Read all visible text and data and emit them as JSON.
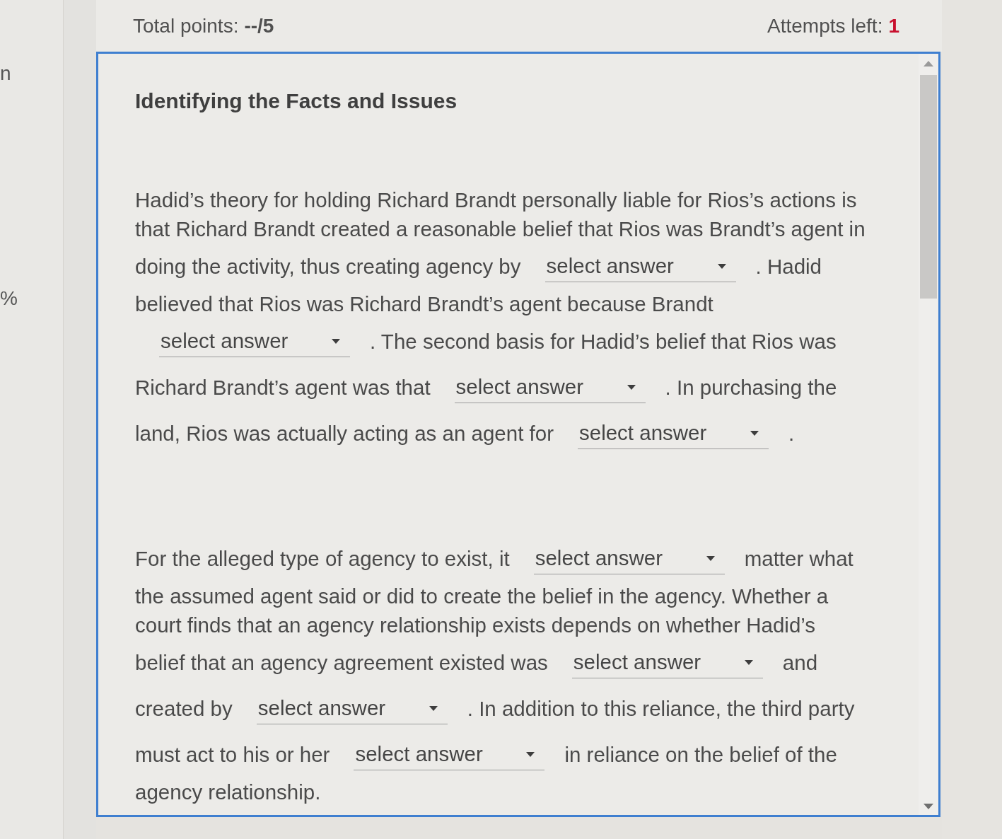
{
  "sidebar_fragments": [
    "n",
    "%"
  ],
  "header": {
    "total_points": {
      "label": "Total points:",
      "value": "--/5"
    },
    "attempts_left": {
      "label": "Attempts left:",
      "value": "1"
    }
  },
  "activity": {
    "title": "Identifying the Facts and Issues",
    "paragraphs": [
      {
        "lines": [
          {
            "parts": [
              {
                "kind": "text",
                "text": "Hadid’s theory for holding Richard Brandt personally liable for Rios’s actions is"
              }
            ]
          },
          {
            "parts": [
              {
                "kind": "text",
                "text": "that Richard Brandt created a reasonable belief that Rios was Brandt’s agent in"
              }
            ]
          },
          {
            "parts": [
              {
                "kind": "text",
                "text": "doing the activity, thus creating agency by"
              },
              {
                "kind": "select",
                "placeholder": "select answer"
              },
              {
                "kind": "text",
                "text": ". Hadid"
              }
            ]
          },
          {
            "parts": [
              {
                "kind": "text",
                "text": "believed that Rios was Richard Brandt’s agent because Brandt"
              }
            ]
          },
          {
            "parts": [
              {
                "kind": "select",
                "placeholder": "select answer"
              },
              {
                "kind": "text",
                "text": ". The second basis for Hadid’s belief that Rios was"
              }
            ]
          },
          {
            "parts": [
              {
                "kind": "text",
                "text": "Richard Brandt’s agent was that"
              },
              {
                "kind": "select",
                "placeholder": "select answer"
              },
              {
                "kind": "text",
                "text": ". In purchasing the"
              }
            ]
          },
          {
            "parts": [
              {
                "kind": "text",
                "text": "land, Rios was actually acting as an agent for"
              },
              {
                "kind": "select",
                "placeholder": "select answer"
              },
              {
                "kind": "text",
                "text": "."
              }
            ]
          }
        ]
      },
      {
        "lines": [
          {
            "parts": [
              {
                "kind": "text",
                "text": "For the alleged type of agency to exist, it"
              },
              {
                "kind": "select",
                "placeholder": "select answer"
              },
              {
                "kind": "text",
                "text": "matter what"
              }
            ]
          },
          {
            "parts": [
              {
                "kind": "text",
                "text": "the assumed agent said or did to create the belief in the agency. Whether a"
              }
            ]
          },
          {
            "parts": [
              {
                "kind": "text",
                "text": "court finds that an agency relationship exists depends on whether Hadid’s"
              }
            ]
          },
          {
            "parts": [
              {
                "kind": "text",
                "text": "belief that an agency agreement existed was"
              },
              {
                "kind": "select",
                "placeholder": "select answer"
              },
              {
                "kind": "text",
                "text": "and"
              }
            ]
          },
          {
            "parts": [
              {
                "kind": "text",
                "text": "created by"
              },
              {
                "kind": "select",
                "placeholder": "select answer"
              },
              {
                "kind": "text",
                "text": ". In addition to this reliance, the third party"
              }
            ]
          },
          {
            "parts": [
              {
                "kind": "text",
                "text": "must act to his or her"
              },
              {
                "kind": "select",
                "placeholder": "select answer"
              },
              {
                "kind": "text",
                "text": "in reliance on the belief of the"
              }
            ]
          },
          {
            "parts": [
              {
                "kind": "text",
                "text": "agency relationship."
              }
            ]
          }
        ]
      }
    ]
  }
}
